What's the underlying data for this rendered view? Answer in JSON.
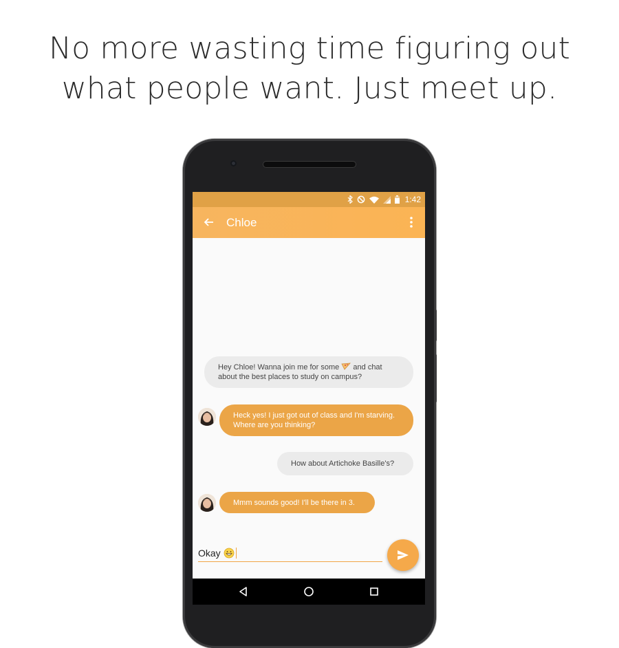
{
  "headline": {
    "line1": "No more wasting time figuring out",
    "line2": "what people want. Just meet up."
  },
  "status_bar": {
    "time": "1:42",
    "icons": [
      "bluetooth-icon",
      "do-not-disturb-icon",
      "wifi-icon",
      "signal-icon",
      "battery-icon"
    ]
  },
  "app_bar": {
    "title": "Chloe",
    "back_icon": "arrow-back-icon",
    "menu_icon": "more-vert-icon"
  },
  "messages": [
    {
      "from": "me",
      "text_before": "Hey Chloe! Wanna join me for some",
      "emoji": "pizza",
      "text_after": "and chat about the best places to study on campus?"
    },
    {
      "from": "Chloe",
      "text": "Heck yes! I just got out of class and I'm starving. Where are you thinking?"
    },
    {
      "from": "me",
      "text": "How about Artichoke Basille's?"
    },
    {
      "from": "Chloe",
      "text": "Mmm sounds good! I'll be there in 3."
    }
  ],
  "compose": {
    "value": "Okay",
    "emoji": "grinning-face"
  },
  "colors": {
    "status_bar": "#e0a146",
    "app_bar": "#fbb454",
    "incoming_bubble": "#eba547",
    "outgoing_bubble": "#ebebeb",
    "send_button": "#f5a94a"
  }
}
